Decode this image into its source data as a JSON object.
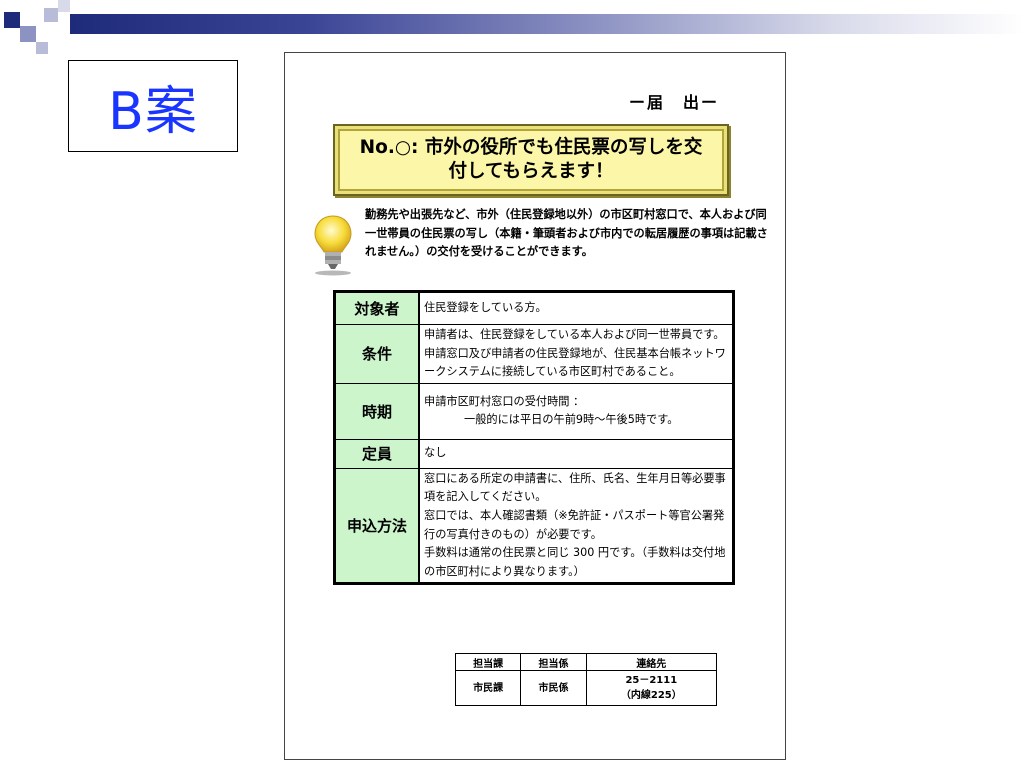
{
  "slide": {
    "plan_label": "B案",
    "colors": {
      "plan_label": "#1a35ff",
      "header_cell": "#ccf5cc",
      "banner": "#fbf6a8",
      "top_bar": "#1e2a7a"
    }
  },
  "doc": {
    "todoke": "ー届　出ー",
    "banner": {
      "line1": "No.○:  市外の役所でも住民票の写しを交",
      "line2": "付してもらえます！"
    },
    "intro": "勤務先や出張先など、市外（住民登録地以外）の市区町村窓口で、本人および同一世帯員の住民票の写し（本籍・筆頭者および市内での転居履歴の事項は記載されません。）の交付を受けることができます。",
    "table": [
      {
        "label": "対象者",
        "lines": [
          "住民登録をしている方。"
        ]
      },
      {
        "label": "条件",
        "lines": [
          "申請者は、住民登録をしている本人および同一世帯員です。",
          "申請窓口及び申請者の住民登録地が、住民基本台帳ネットワークシステムに接続している市区町村であること。"
        ]
      },
      {
        "label": "時期",
        "lines": [
          "申請市区町村窓口の受付時間 ：",
          "一般的には平日の午前9時～午後5時です。"
        ]
      },
      {
        "label": "定員",
        "lines": [
          "なし"
        ]
      },
      {
        "label": "申込方法",
        "lines": [
          "窓口にある所定の申請書に、住所、氏名、生年月日等必要事項を記入してください。",
          "窓口では、本人確認書類（※免許証・パスポート等官公署発行の写真付きのもの）が必要です。",
          "手数料は通常の住民票と同じ 300 円です。（手数料は交付地の市区町村により異なります。）"
        ]
      }
    ],
    "contact": {
      "headers": [
        "担当課",
        "担当係",
        "連絡先"
      ],
      "row": [
        "市民課",
        "市民係",
        "25－2111",
        "（内線225）"
      ]
    },
    "icons": [
      "lightbulb-icon"
    ]
  }
}
